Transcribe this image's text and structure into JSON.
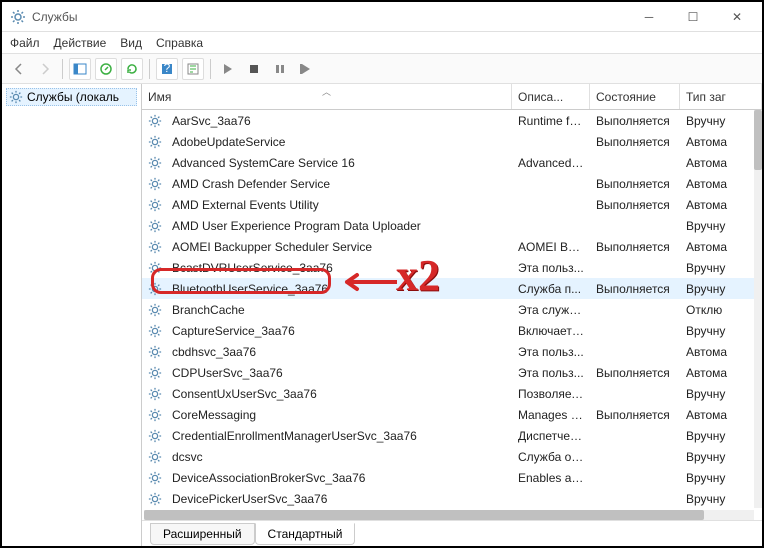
{
  "window": {
    "title": "Службы"
  },
  "menu": {
    "file": "Файл",
    "action": "Действие",
    "view": "Вид",
    "help": "Справка"
  },
  "tree": {
    "root": "Службы (локаль"
  },
  "columns": {
    "name": "Имя",
    "desc": "Описа...",
    "state": "Состояние",
    "start": "Тип заг"
  },
  "tabs": {
    "ext": "Расширенный",
    "std": "Стандартный"
  },
  "annotate": {
    "x2": "x2"
  },
  "services": [
    {
      "name": "AarSvc_3aa76",
      "desc": "Runtime fo...",
      "state": "Выполняется",
      "start": "Вручну"
    },
    {
      "name": "AdobeUpdateService",
      "desc": "",
      "state": "Выполняется",
      "start": "Автома"
    },
    {
      "name": "Advanced SystemCare Service 16",
      "desc": "Advanced ...",
      "state": "",
      "start": "Автома"
    },
    {
      "name": "AMD Crash Defender Service",
      "desc": "",
      "state": "Выполняется",
      "start": "Автома"
    },
    {
      "name": "AMD External Events Utility",
      "desc": "",
      "state": "Выполняется",
      "start": "Автома"
    },
    {
      "name": "AMD User Experience Program Data Uploader",
      "desc": "",
      "state": "",
      "start": "Вручну"
    },
    {
      "name": "AOMEI Backupper Scheduler Service",
      "desc": "AOMEI Bac...",
      "state": "Выполняется",
      "start": "Автома"
    },
    {
      "name": "BcastDVRUserService_3aa76",
      "desc": "Эта польз...",
      "state": "",
      "start": "Вручну"
    },
    {
      "name": "BluetoothUserService_3aa76",
      "desc": "Служба п...",
      "state": "Выполняется",
      "start": "Вручну",
      "selected": true
    },
    {
      "name": "BranchCache",
      "desc": "Эта служб...",
      "state": "",
      "start": "Отклю"
    },
    {
      "name": "CaptureService_3aa76",
      "desc": "Включает ...",
      "state": "",
      "start": "Вручну"
    },
    {
      "name": "cbdhsvc_3aa76",
      "desc": "Эта польз...",
      "state": "",
      "start": "Автома"
    },
    {
      "name": "CDPUserSvc_3aa76",
      "desc": "Эта польз...",
      "state": "Выполняется",
      "start": "Автома"
    },
    {
      "name": "ConsentUxUserSvc_3aa76",
      "desc": "Позволяет...",
      "state": "",
      "start": "Вручну"
    },
    {
      "name": "CoreMessaging",
      "desc": "Manages c...",
      "state": "Выполняется",
      "start": "Автома"
    },
    {
      "name": "CredentialEnrollmentManagerUserSvc_3aa76",
      "desc": "Диспетчер...",
      "state": "",
      "start": "Вручну"
    },
    {
      "name": "dcsvc",
      "desc": "Служба об...",
      "state": "",
      "start": "Вручну"
    },
    {
      "name": "DeviceAssociationBrokerSvc_3aa76",
      "desc": "Enables ap...",
      "state": "",
      "start": "Вручну"
    },
    {
      "name": "DevicePickerUserSvc_3aa76",
      "desc": "",
      "state": "",
      "start": "Вручну"
    }
  ]
}
